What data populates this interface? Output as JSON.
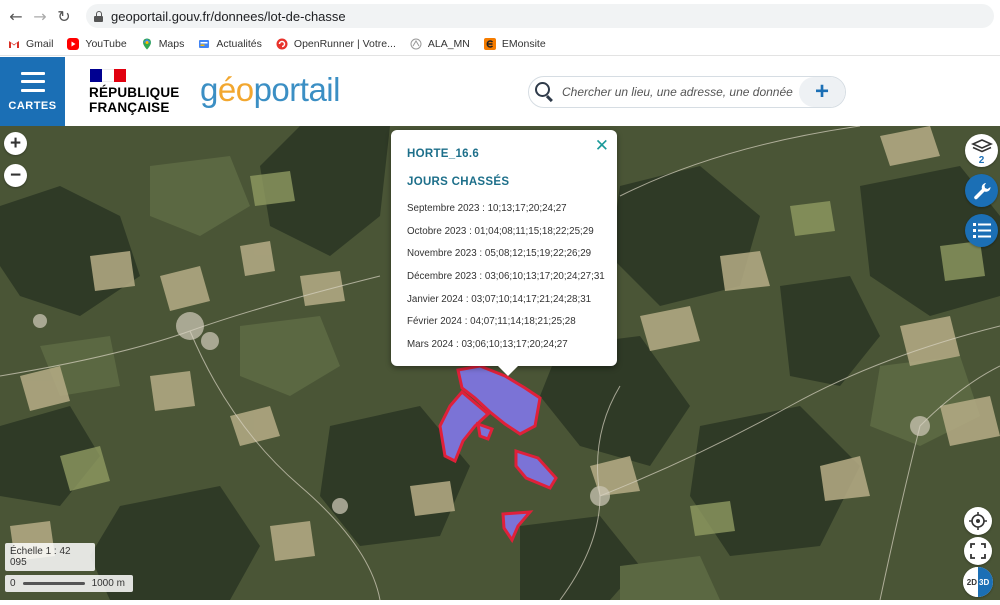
{
  "browser": {
    "url": "geoportail.gouv.fr/donnees/lot-de-chasse",
    "bookmarks": [
      {
        "label": "Gmail",
        "icon": "gmail-icon"
      },
      {
        "label": "YouTube",
        "icon": "youtube-icon"
      },
      {
        "label": "Maps",
        "icon": "maps-icon"
      },
      {
        "label": "Actualités",
        "icon": "news-icon"
      },
      {
        "label": "OpenRunner | Votre...",
        "icon": "openrunner-icon"
      },
      {
        "label": "ALA_MN",
        "icon": "ala-icon"
      },
      {
        "label": "EMonsite",
        "icon": "emonsite-icon"
      }
    ]
  },
  "header": {
    "menu_label": "CARTES",
    "republique_line1": "RÉPUBLIQUE",
    "republique_line2": "FRANÇAISE",
    "logo_part1": "g",
    "logo_part2": "éo",
    "logo_part3": "portail",
    "search_placeholder": "Chercher un lieu, une adresse, une donnée",
    "plus_label": "+"
  },
  "map": {
    "zoom_in": "+",
    "zoom_out": "−",
    "layer_count": "2",
    "scale_label": "Échelle 1 : 42 095",
    "scale_start": "0",
    "scale_end": "1000 m",
    "view_2d": "2D",
    "view_3d": "3D",
    "parcel_color": "#e0203a",
    "parcel_fill": "#7b73d6"
  },
  "popup": {
    "title": "HORTE_16.6",
    "subtitle": "JOURS CHASSÉS",
    "rows": [
      "Septembre 2023 : 10;13;17;20;24;27",
      "Octobre 2023 : 01;04;08;11;15;18;22;25;29",
      "Novembre 2023 : 05;08;12;15;19;22;26;29",
      "Décembre 2023 : 03;06;10;13;17;20;24;27;31",
      "Janvier 2024 : 03;07;10;14;17;21;24;28;31",
      "Février 2024 : 04;07;11;14;18;21;25;28",
      "Mars 2024 : 03;06;10;13;17;20;24;27"
    ]
  }
}
